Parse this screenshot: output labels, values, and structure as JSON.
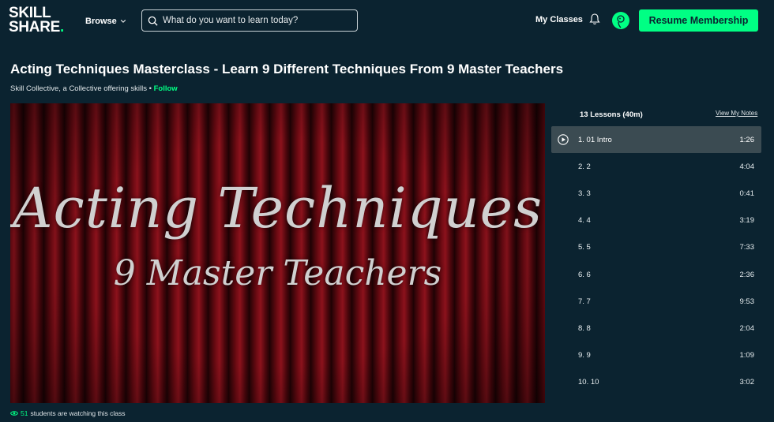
{
  "header": {
    "logo_line1": "SKILL",
    "logo_line2": "SHARE",
    "logo_dot": ".",
    "browse_label": "Browse",
    "search_placeholder": "What do you want to learn today?",
    "my_classes_label": "My Classes",
    "resume_label": "Resume Membership"
  },
  "course": {
    "title": "Acting Techniques Masterclass - Learn 9 Different Techniques From 9 Master Teachers",
    "author": "Skill Collective, a Collective offering skills",
    "separator": " • ",
    "follow_label": "Follow"
  },
  "video": {
    "overlay_line1": "Acting Techniques",
    "overlay_line2": "9 Master Teachers"
  },
  "lessons": {
    "header": "13 Lessons (40m)",
    "view_notes": "View My Notes",
    "items": [
      {
        "label": "1. 01 Intro",
        "duration": "1:26"
      },
      {
        "label": "2. 2",
        "duration": "4:04"
      },
      {
        "label": "3. 3",
        "duration": "0:41"
      },
      {
        "label": "4. 4",
        "duration": "3:19"
      },
      {
        "label": "5. 5",
        "duration": "7:33"
      },
      {
        "label": "6. 6",
        "duration": "2:36"
      },
      {
        "label": "7. 7",
        "duration": "9:53"
      },
      {
        "label": "8. 8",
        "duration": "2:04"
      },
      {
        "label": "9. 9",
        "duration": "1:09"
      },
      {
        "label": "10. 10",
        "duration": "3:02"
      }
    ]
  },
  "footer": {
    "watching_count": "51",
    "watching_text": "students are watching this class"
  },
  "colors": {
    "background": "#0b2330",
    "accent": "#00ff84",
    "active_row": "#3b4b52"
  }
}
